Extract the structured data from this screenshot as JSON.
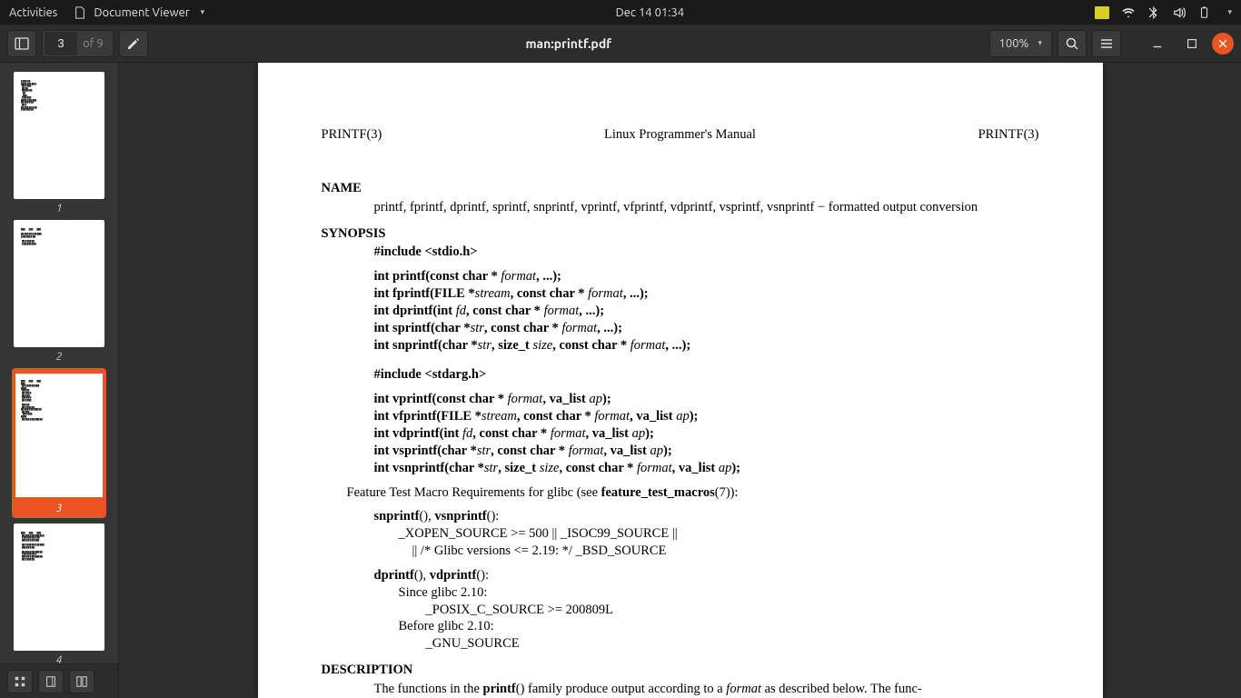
{
  "topbar": {
    "activities": "Activities",
    "appname": "Document Viewer",
    "clock": "Dec 14  01:34"
  },
  "toolbar": {
    "page_current": "3",
    "page_of": "of 9",
    "title": "man:printf.pdf",
    "zoom": "100%"
  },
  "thumbs": {
    "labels": [
      "1",
      "2",
      "3",
      "4"
    ],
    "selected": 3
  },
  "doc": {
    "hdr_left": "PRINTF(3)",
    "hdr_center": "Linux Programmer's Manual",
    "hdr_right": "PRINTF(3)",
    "sect_name": "NAME",
    "name_body": "printf, fprintf, dprintf, sprintf, snprintf, vprintf, vfprintf, vdprintf, vsprintf, vsnprintf − formatted output conversion",
    "sect_syn": "SYNOPSIS",
    "inc1": "#include <stdio.h>",
    "inc2": "#include <stdarg.h>",
    "ftm_prefix": "Feature Test Macro Requirements for glibc (see ",
    "ftm_bold": "feature_test_macros",
    "ftm_suffix": "(7)):",
    "req1a": "snprintf",
    "req1b": "vsnprintf",
    "req1_l1": "_XOPEN_SOURCE >= 500 || _ISOC99_SOURCE ||",
    "req1_l2": "|| /* Glibc versions <= 2.19: */ _BSD_SOURCE",
    "req2a": "dprintf",
    "req2b": "vdprintf",
    "req2_l1": "Since glibc 2.10:",
    "req2_l2": "_POSIX_C_SOURCE >= 200809L",
    "req2_l3": "Before glibc 2.10:",
    "req2_l4": "_GNU_SOURCE",
    "sect_desc": "DESCRIPTION",
    "desc_prefix": "The functions in the ",
    "desc_bold": "printf",
    "desc_mid": "() family produce output according to a ",
    "desc_italic": "format",
    "desc_suffix": " as described below.  The func-"
  }
}
